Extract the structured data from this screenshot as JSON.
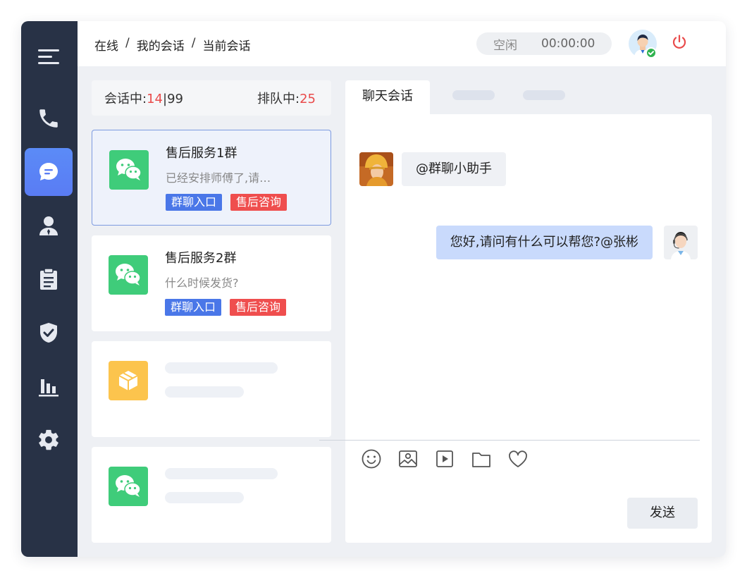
{
  "sidebar": {
    "items": [
      {
        "name": "menu",
        "icon": "menu-icon"
      },
      {
        "name": "phone",
        "icon": "phone-icon"
      },
      {
        "name": "chat",
        "icon": "chat-bubble-icon",
        "active": true
      },
      {
        "name": "contacts",
        "icon": "user-icon"
      },
      {
        "name": "records",
        "icon": "clipboard-icon"
      },
      {
        "name": "security",
        "icon": "shield-check-icon"
      },
      {
        "name": "reports",
        "icon": "bar-chart-icon"
      },
      {
        "name": "settings",
        "icon": "gear-icon"
      }
    ]
  },
  "header": {
    "breadcrumb": [
      "在线",
      "我的会话",
      "当前会话"
    ],
    "breadcrumb_sep": "/",
    "status": "空闲",
    "timer": "00:00:00"
  },
  "sessions": {
    "in_session_label": "会话中:",
    "in_session_count": "14",
    "in_session_sep": "|",
    "in_session_total": "99",
    "queue_label": "排队中:",
    "queue_count": "25",
    "cards": [
      {
        "title": "售后服务1群",
        "preview": "已经安排师傅了,请…",
        "tags": [
          "群聊入口",
          "售后咨询"
        ],
        "icon": "wechat-icon",
        "active": true
      },
      {
        "title": "售后服务2群",
        "preview": "什么时候发货?",
        "tags": [
          "群聊入口",
          "售后咨询"
        ],
        "icon": "wechat-icon",
        "active": false
      },
      {
        "title": "",
        "preview": "",
        "tags": [],
        "icon": "package-box-icon",
        "placeholder": true
      },
      {
        "title": "",
        "preview": "",
        "tags": [],
        "icon": "wechat-icon",
        "placeholder": true
      }
    ]
  },
  "chat": {
    "tab_label": "聊天会话",
    "messages": [
      {
        "direction": "in",
        "text": "@群聊小助手"
      },
      {
        "direction": "out",
        "text": "您好,请问有什么可以帮您?@张彬"
      }
    ],
    "tools": [
      "emoji-icon",
      "image-icon",
      "video-icon",
      "folder-icon",
      "heart-icon"
    ],
    "send_label": "发送"
  },
  "colors": {
    "sidebar_bg": "#283246",
    "accent": "#5a7cf4",
    "red": "#e94b4b",
    "wechat_green": "#3fcc7a",
    "package_yellow": "#fcc44d",
    "tag_blue": "#4a77e8",
    "tag_red": "#ef4e4e"
  }
}
